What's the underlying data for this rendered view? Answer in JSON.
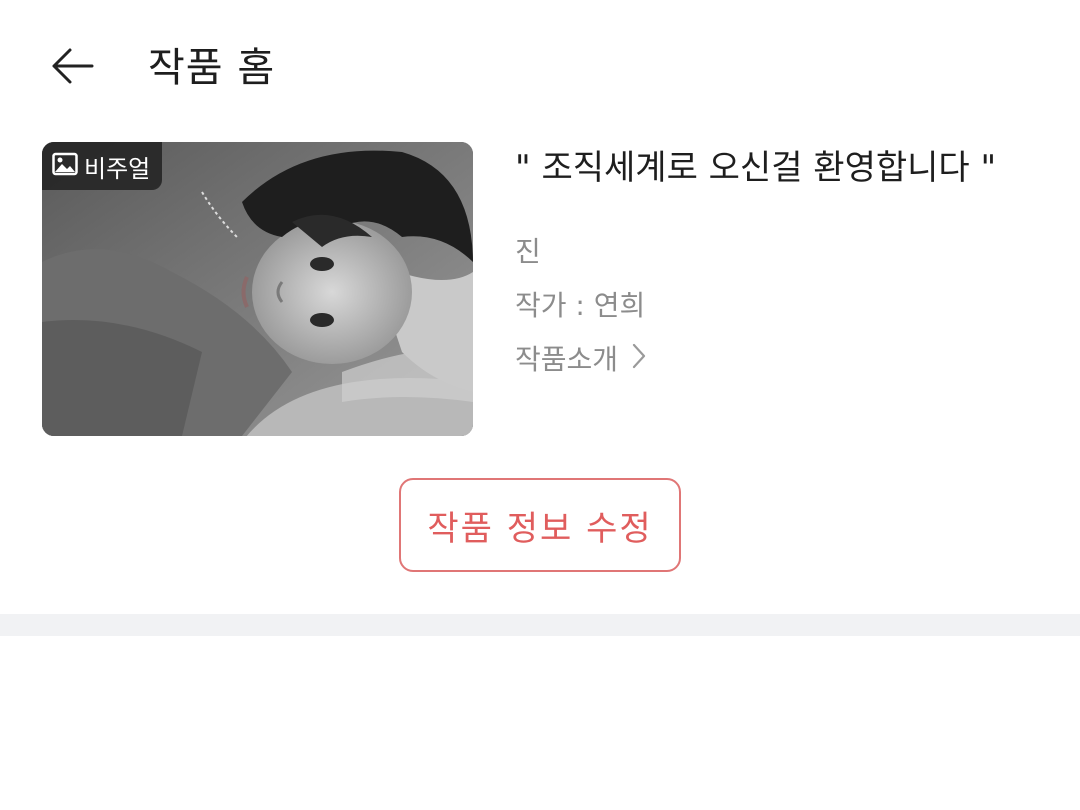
{
  "header": {
    "title": "작품 홈",
    "back_icon": "arrow-left-icon"
  },
  "work": {
    "cover_badge": "비주얼",
    "badge_icon": "image-icon",
    "title": "\" 조직세계로 오신걸 환영합니다 \"",
    "genre": "진",
    "author": "작가 : 연희",
    "intro_label": "작품소개",
    "intro_icon": "chevron-right-icon"
  },
  "actions": {
    "edit_label": "작품 정보 수정"
  },
  "colors": {
    "accent": "#e05d5d",
    "muted_text": "#8c8c8c",
    "divider": "#f1f2f4"
  }
}
